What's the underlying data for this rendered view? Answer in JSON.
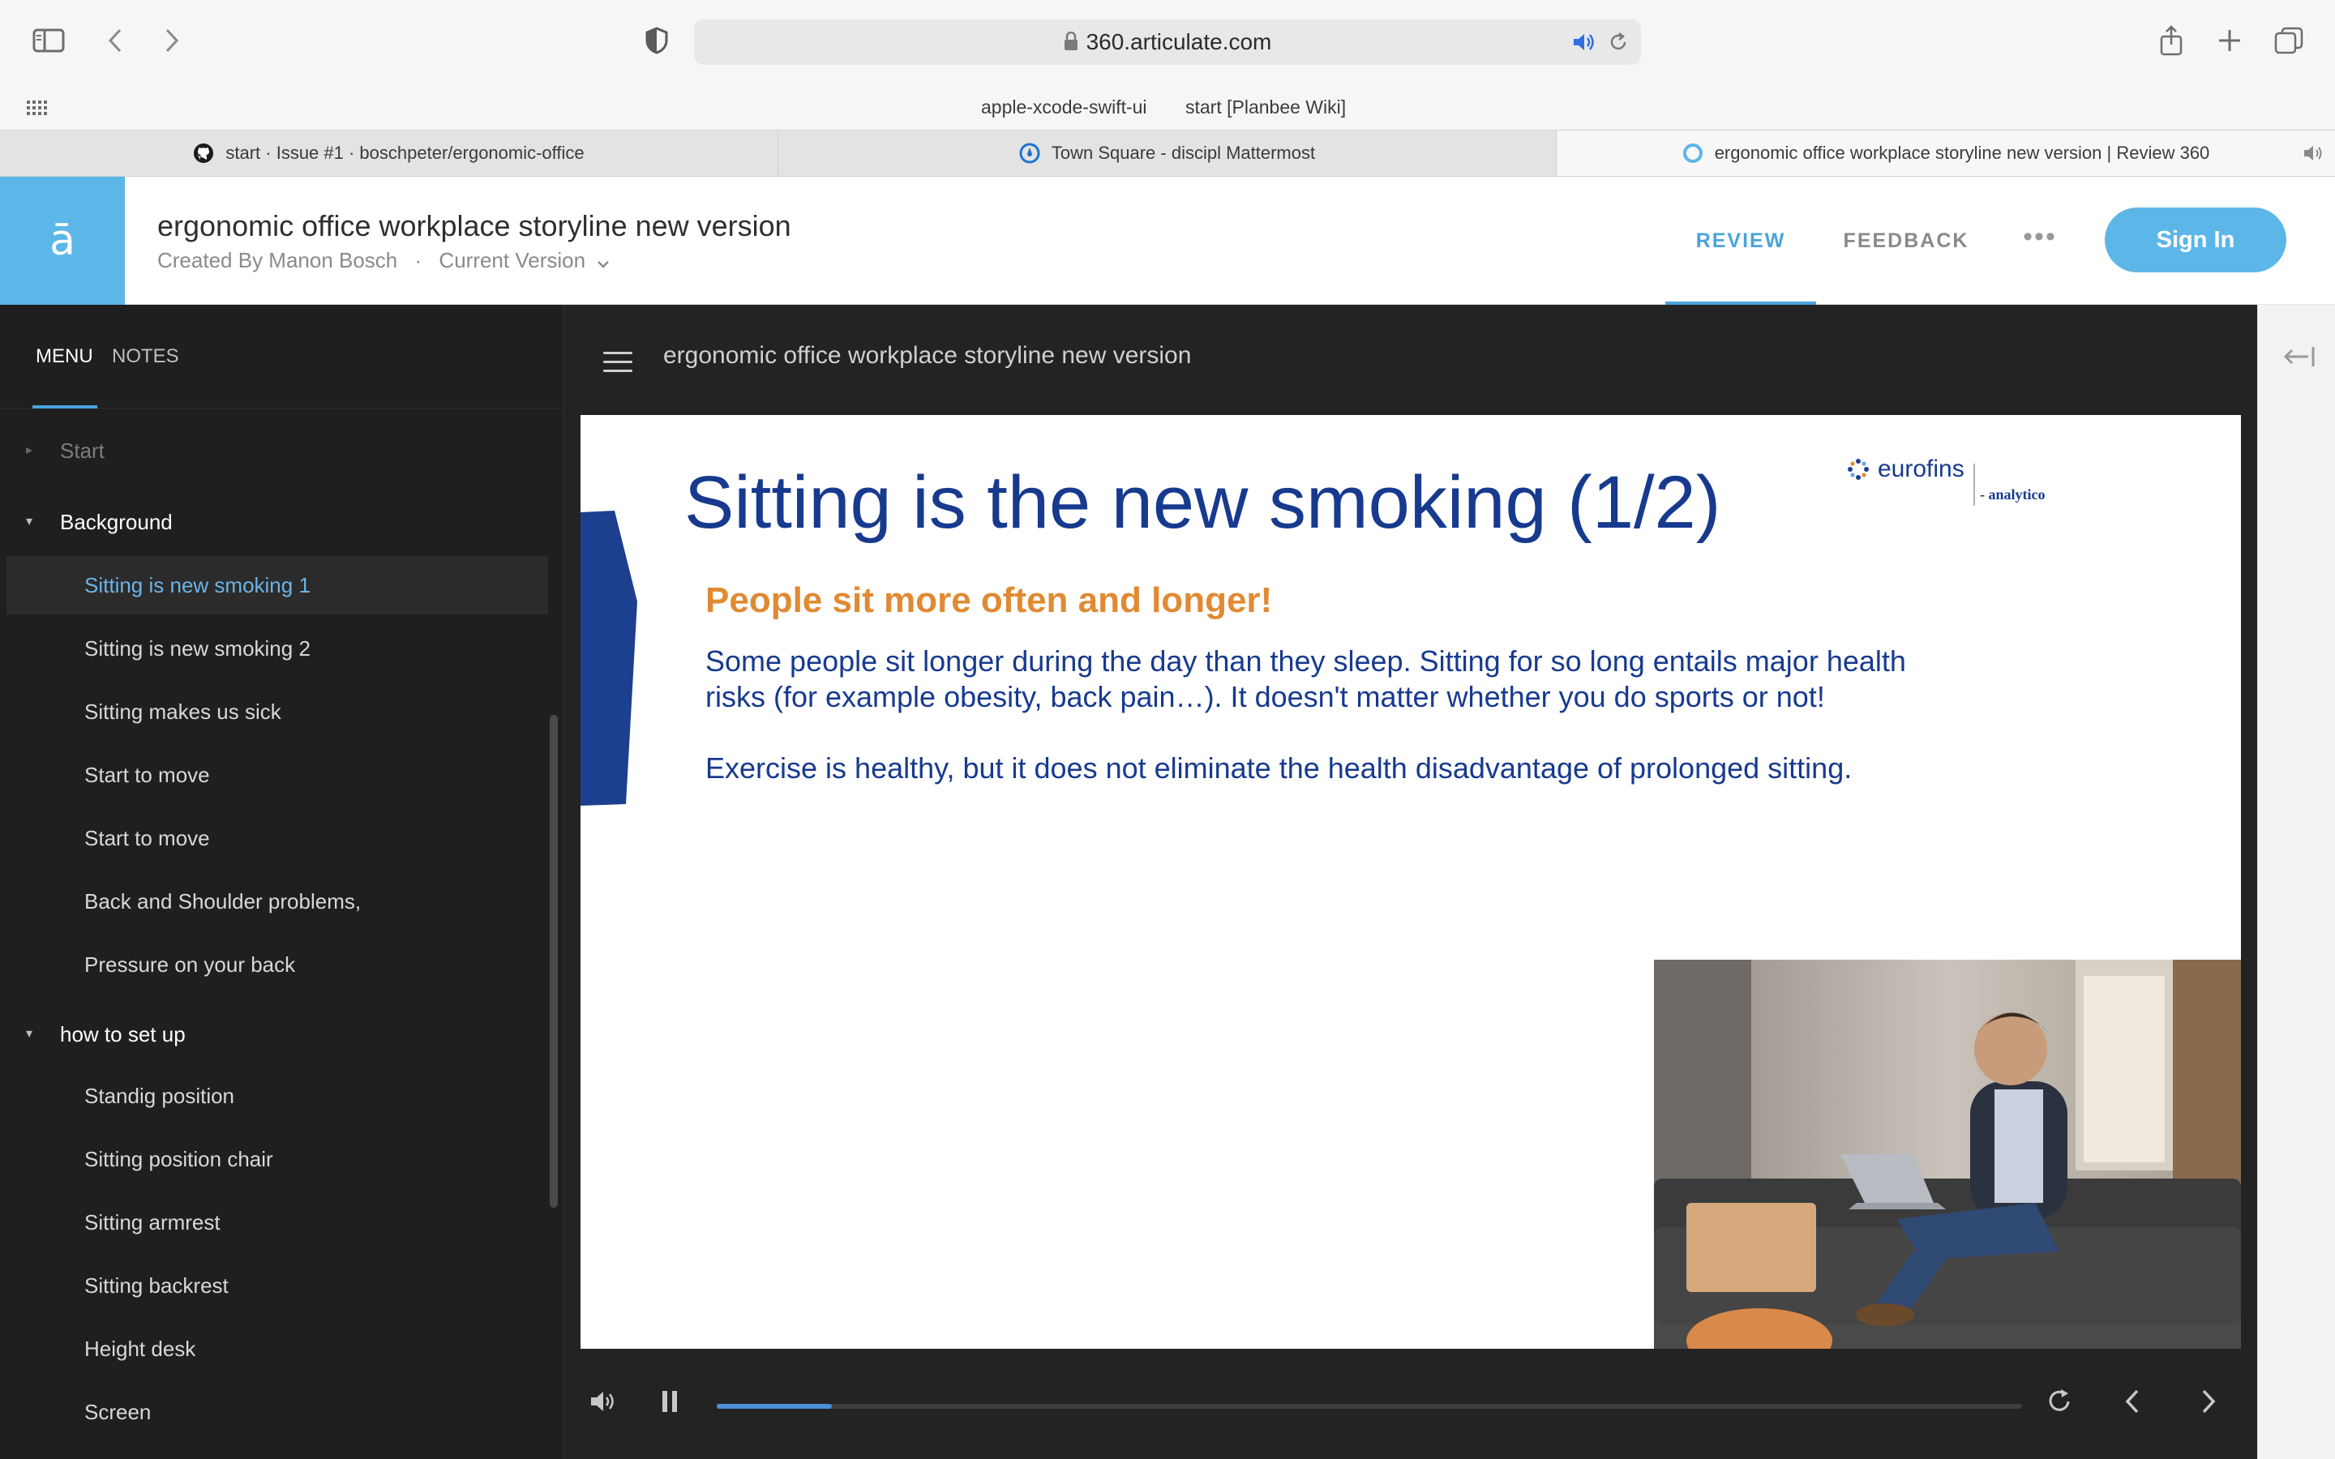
{
  "browser": {
    "url": "360.articulate.com",
    "favorites": [
      "apple-xcode-swift-ui",
      "start [Planbee Wiki]"
    ],
    "tabs": [
      {
        "label": "start · Issue #1 · boschpeter/ergonomic-office",
        "icon": "github-icon",
        "active": false
      },
      {
        "label": "Town Square - discipl Mattermost",
        "icon": "mattermost-icon",
        "active": false
      },
      {
        "label": "ergonomic office workplace storyline new version | Review 360",
        "icon": "review360-icon",
        "active": true
      }
    ]
  },
  "header": {
    "logo": "ā",
    "title": "ergonomic office workplace storyline new version",
    "created_by": "Created By Manon Bosch",
    "separator": "·",
    "version": "Current Version",
    "nav_review": "REVIEW",
    "nav_feedback": "FEEDBACK",
    "more": "•••",
    "signin": "Sign In",
    "accent_color": "#5db6e8"
  },
  "sidebar": {
    "tab_menu": "MENU",
    "tab_notes": "NOTES",
    "items": [
      {
        "label": "Start",
        "kind": "section-collapsed"
      },
      {
        "label": "Background",
        "kind": "section-open"
      },
      {
        "label": "Sitting is new smoking 1",
        "kind": "current"
      },
      {
        "label": "Sitting is new smoking 2",
        "kind": "child"
      },
      {
        "label": "Sitting makes us sick",
        "kind": "child"
      },
      {
        "label": "Start to move",
        "kind": "child"
      },
      {
        "label": "Start to move",
        "kind": "child"
      },
      {
        "label": "Back and Shoulder problems,",
        "kind": "child"
      },
      {
        "label": "Pressure on your back",
        "kind": "child"
      },
      {
        "label": "how to set up",
        "kind": "section-open"
      },
      {
        "label": "Standig position",
        "kind": "child"
      },
      {
        "label": "Sitting position chair",
        "kind": "child"
      },
      {
        "label": "Sitting armrest",
        "kind": "child"
      },
      {
        "label": "Sitting backrest",
        "kind": "child"
      },
      {
        "label": "Height desk",
        "kind": "child"
      },
      {
        "label": "Screen",
        "kind": "child"
      }
    ]
  },
  "stage": {
    "title": "ergonomic office workplace storyline new version",
    "progress": 0.088
  },
  "slide": {
    "title": "Sitting is the new smoking (1/2)",
    "subtitle": "People sit more often and longer!",
    "paragraph1_line1": "Some people sit longer during the day than they sleep. Sitting for so long entails major health",
    "paragraph1_line2": "risks (for example obesity, back pain…). It doesn't matter whether you do sports or not!",
    "paragraph2": "Exercise is healthy, but it does not eliminate the health disadvantage of prolonged sitting.",
    "logo_main": "eurofins",
    "logo_sub": "- analytico",
    "title_color": "#173a8f",
    "subtitle_color": "#e08a33"
  }
}
